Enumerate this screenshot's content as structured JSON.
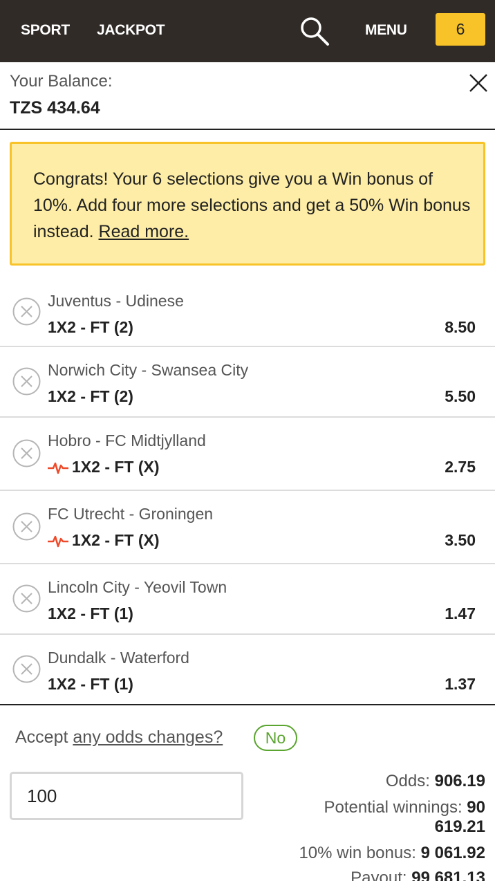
{
  "header": {
    "sport_label": "SPORT",
    "jackpot_label": "JACKPOT",
    "menu_label": "MENU",
    "betslip_count": "6",
    "accent_color": "#f7c328",
    "bar_color": "#302b27"
  },
  "balance": {
    "label": "Your Balance:",
    "value": "TZS 434.64"
  },
  "bonus_banner": {
    "text": "Congrats! Your 6 selections give you a Win bonus of 10%. Add four more selections and get a 50% Win bonus instead.",
    "link_text": "Read more."
  },
  "selections": [
    {
      "match": "Juventus - Udinese",
      "market": "1X2 - FT (2)",
      "odds": "8.50",
      "live": false
    },
    {
      "match": "Norwich City - Swansea City",
      "market": "1X2 - FT (2)",
      "odds": "5.50",
      "live": false
    },
    {
      "match": "Hobro - FC Midtjylland",
      "market": "1X2 - FT (X)",
      "odds": "2.75",
      "live": true
    },
    {
      "match": "FC Utrecht - Groningen",
      "market": "1X2 - FT (X)",
      "odds": "3.50",
      "live": true
    },
    {
      "match": "Lincoln City - Yeovil Town",
      "market": "1X2 - FT (1)",
      "odds": "1.47",
      "live": false
    },
    {
      "match": "Dundalk - Waterford",
      "market": "1X2 - FT (1)",
      "odds": "1.37",
      "live": false
    }
  ],
  "accept_odds": {
    "prefix": "Accept",
    "link_text": "any odds changes?",
    "toggle_value": "No"
  },
  "stake": {
    "value": "100"
  },
  "summary": {
    "odds_label": "Odds:",
    "odds_value": "906.19",
    "potential_label": "Potential winnings:",
    "potential_value_line1": "90",
    "potential_value_line2": "619.21",
    "bonus_label": "10% win bonus:",
    "bonus_value": "9 061.92",
    "payout_label": "Payout:",
    "payout_value": "99 681.13"
  }
}
